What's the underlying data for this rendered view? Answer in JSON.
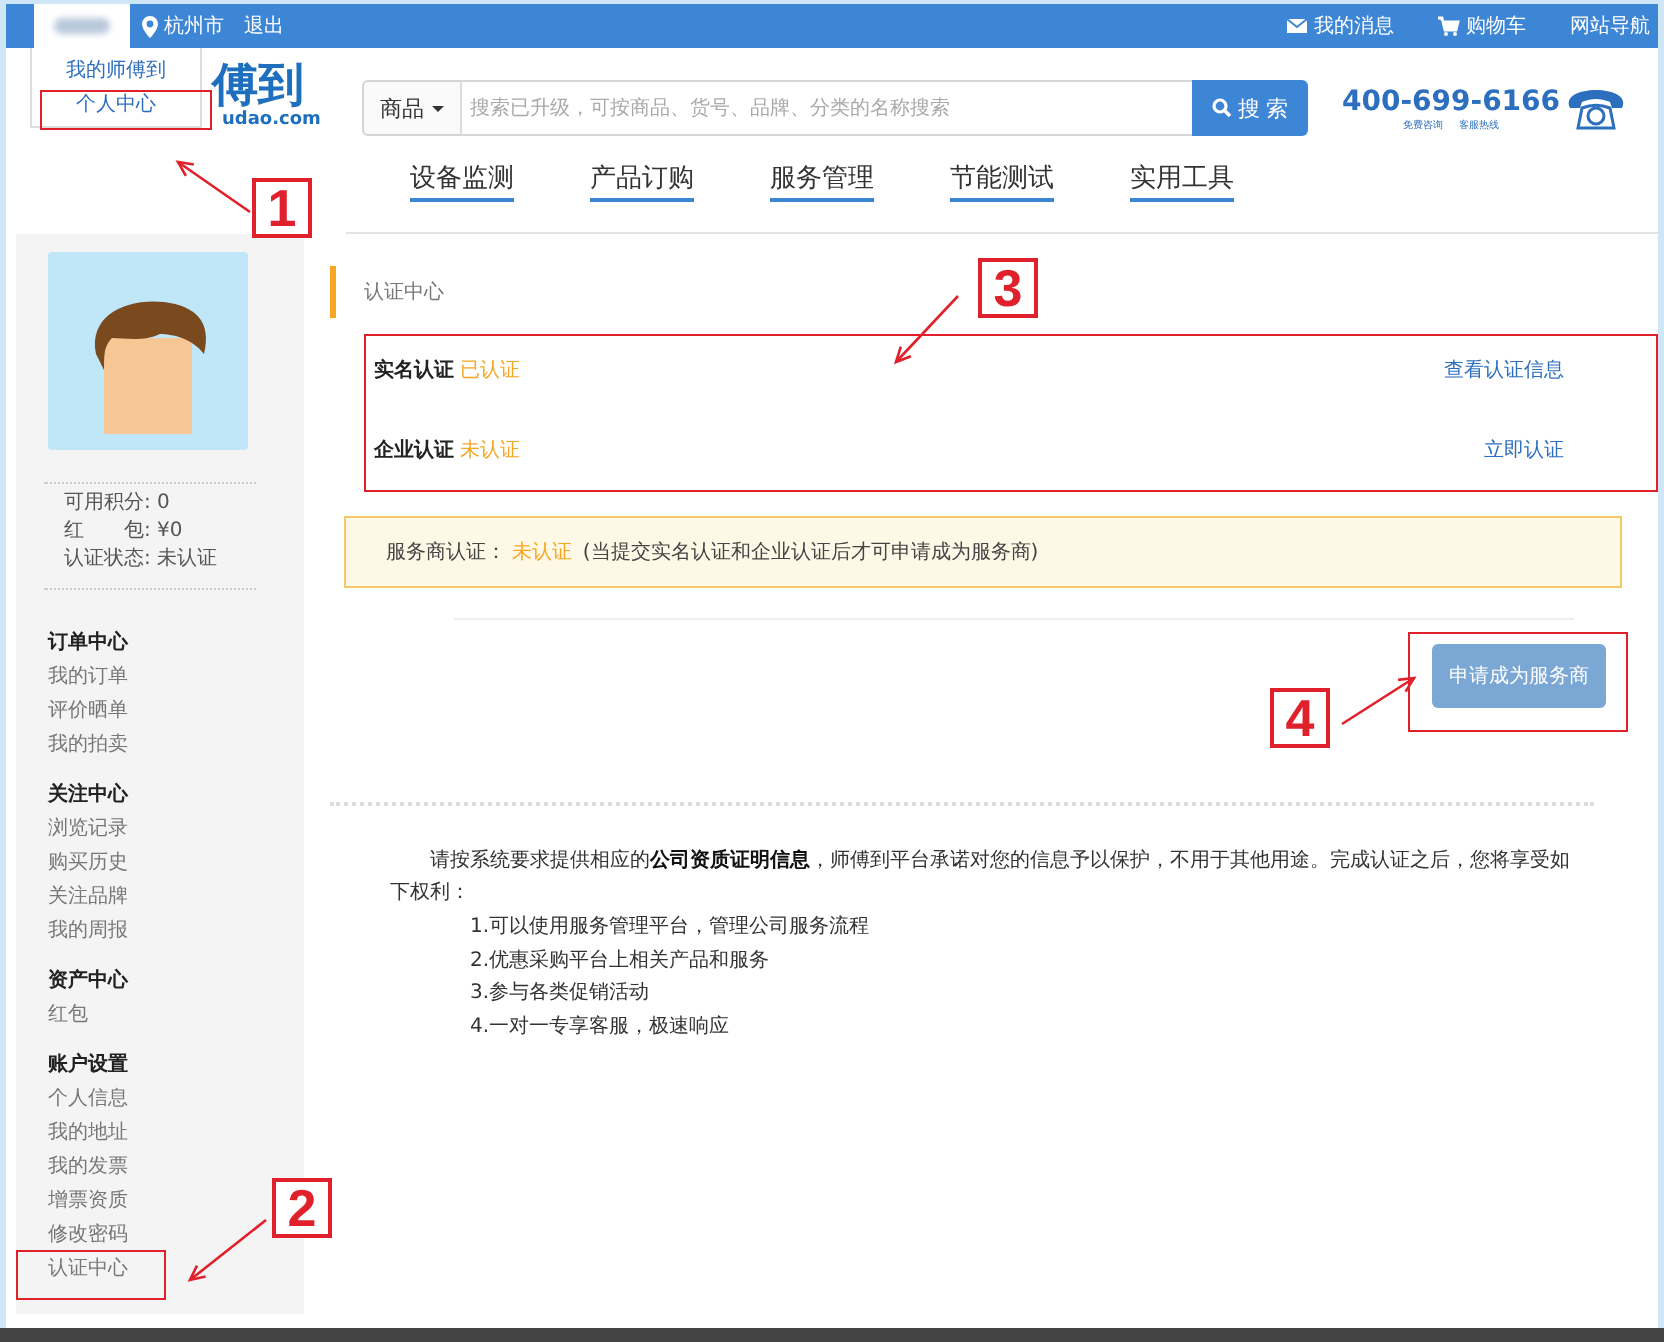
{
  "top_bar": {
    "city": "杭州市",
    "logout": "退出",
    "links": [
      {
        "kind": "message",
        "label": "我的消息"
      },
      {
        "kind": "cart",
        "label": "购物车"
      },
      {
        "kind": "plain",
        "label": "网站导航"
      }
    ]
  },
  "account_menu": {
    "items": [
      "我的师傅到",
      "个人中心"
    ]
  },
  "logo": {
    "name": "傅到",
    "domain": "udao.com"
  },
  "search": {
    "category": "商品",
    "placeholder": "搜索已升级，可按商品、货号、品牌、分类的名称搜索",
    "button": "搜 索"
  },
  "hotline": {
    "number": "400-699-6166",
    "captions": [
      "免费咨询",
      "客服热线"
    ]
  },
  "nav": [
    "设备监测",
    "产品订购",
    "服务管理",
    "节能测试",
    "实用工具"
  ],
  "profile": {
    "stats": [
      {
        "label": "可用积分:",
        "value": "0"
      },
      {
        "label": "红　　包:",
        "value": "¥0"
      },
      {
        "label": "认证状态:",
        "value": "未认证"
      }
    ]
  },
  "sidebar": {
    "groups": [
      {
        "title": "订单中心",
        "items": [
          "我的订单",
          "评价晒单",
          "我的拍卖"
        ]
      },
      {
        "title": "关注中心",
        "items": [
          "浏览记录",
          "购买历史",
          "关注品牌",
          "我的周报"
        ]
      },
      {
        "title": "资产中心",
        "items": [
          "红包"
        ]
      },
      {
        "title": "账户设置",
        "items": [
          "个人信息",
          "我的地址",
          "我的发票",
          "增票资质",
          "修改密码",
          "认证中心"
        ]
      }
    ]
  },
  "main": {
    "section_title": "认证中心",
    "verifications": [
      {
        "name": "实名认证",
        "status": "已认证",
        "action": "查看认证信息"
      },
      {
        "name": "企业认证",
        "status": "未认证",
        "action": "立即认证"
      }
    ],
    "notice": {
      "label": "服务商认证：",
      "status": "未认证",
      "note": "(当提交实名认证和企业认证后才可申请成为服务商)"
    },
    "apply_button": "申请成为服务商",
    "intro": "请按系统要求提供相应的**公司资质证明信息**，师傅到平台承诺对您的信息予以保护，不用于其他用途。完成认证之后，您将享受如下权利：",
    "benefits": [
      "1.可以使用服务管理平台，管理公司服务流程",
      "2.优惠采购平台上相关产品和服务",
      "3.参与各类促销活动",
      "4.一对一专享客服，极速响应"
    ]
  },
  "annotations": [
    {
      "number": "1"
    },
    {
      "number": "2"
    },
    {
      "number": "3"
    },
    {
      "number": "4"
    }
  ]
}
